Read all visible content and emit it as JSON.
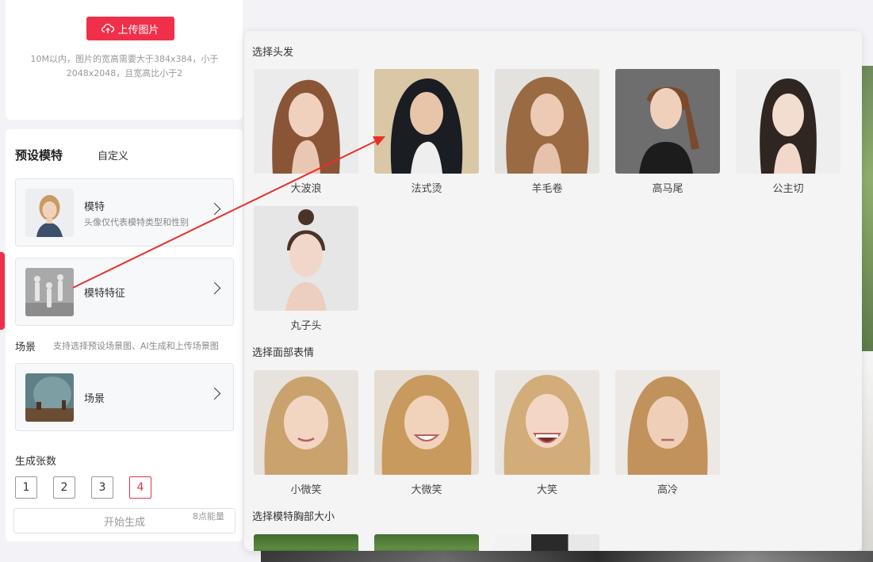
{
  "upload": {
    "button_label": "上传图片",
    "hint": "10M以内，图片的宽高需要大于384x384，小于2048x2048，且宽高比小于2"
  },
  "tabs": {
    "preset": "预设模特",
    "custom": "自定义"
  },
  "model_option": {
    "title": "模特",
    "subtitle": "头像仅代表模特类型和性别"
  },
  "feature_option": {
    "title": "模特特征"
  },
  "scene": {
    "label": "场景",
    "hint": "支持选择预设场景图、AI生成和上传场景图",
    "option_title": "场景"
  },
  "count": {
    "label": "生成张数",
    "options": [
      "1",
      "2",
      "3",
      "4"
    ],
    "selected": "4"
  },
  "generate": {
    "label": "开始生成",
    "cost": "8点能量"
  },
  "popup": {
    "hair_title": "选择头发",
    "hair_items": [
      "大波浪",
      "法式烫",
      "羊毛卷",
      "高马尾",
      "公主切",
      "丸子头"
    ],
    "expression_title": "选择面部表情",
    "expression_items": [
      "小微笑",
      "大微笑",
      "大笑",
      "高冷"
    ],
    "chest_title": "选择模特胸部大小"
  },
  "colors": {
    "accent": "#f0304a",
    "annotation_arrow": "#e8302a"
  }
}
